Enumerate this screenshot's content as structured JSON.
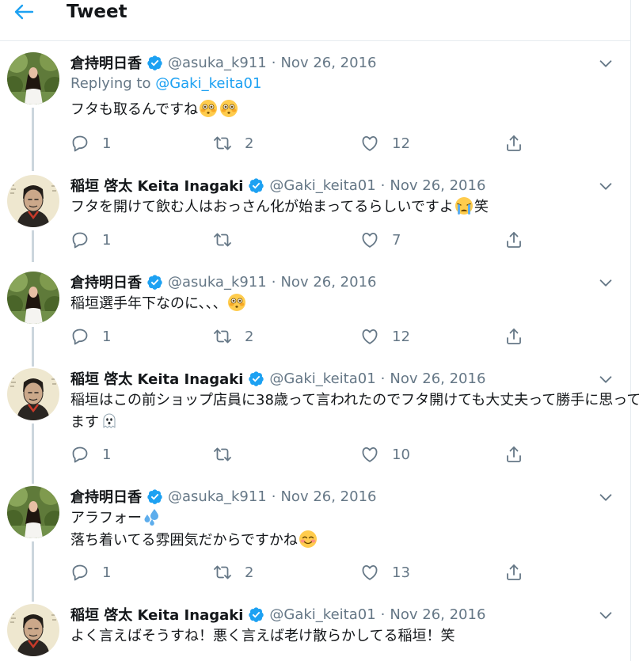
{
  "header": {
    "title": "Tweet"
  },
  "colors": {
    "accent": "#1da1f2",
    "muted": "#657786",
    "text": "#14171a",
    "thread_line": "#ccd6dd"
  },
  "tweets": [
    {
      "name": "倉持明日香",
      "handle": "@asuka_k911",
      "separator": "·",
      "time": "Nov 26, 2016",
      "replying_label": "Replying to ",
      "replying_handle": "@Gaki_keita01",
      "lines": [
        "フタも取るんですね"
      ],
      "emoji": [
        "flushed-face",
        "flushed-face"
      ],
      "replies": "1",
      "retweets": "2",
      "likes": "12"
    },
    {
      "name": "稲垣 啓太 Keita Inagaki",
      "handle": "@Gaki_keita01",
      "separator": "·",
      "time": "Nov 26, 2016",
      "lines": [
        "フタを開けて飲む人はおっさん化が始まってるらしいですよ",
        "笑"
      ],
      "emoji": [
        "loudly-crying-face"
      ],
      "replies": "1",
      "retweets": "",
      "likes": "7"
    },
    {
      "name": "倉持明日香",
      "handle": "@asuka_k911",
      "separator": "·",
      "time": "Nov 26, 2016",
      "lines": [
        "稲垣選手年下なのに、、、"
      ],
      "emoji": [
        "flushed-face"
      ],
      "replies": "1",
      "retweets": "2",
      "likes": "12"
    },
    {
      "name": "稲垣 啓太 Keita Inagaki",
      "handle": "@Gaki_keita01",
      "separator": "·",
      "time": "Nov 26, 2016",
      "lines": [
        "稲垣はこの前ショップ店員に38歳って言われたのでフタ開けても大丈夫って勝手に思って",
        "ます"
      ],
      "emoji": [
        "ghost"
      ],
      "replies": "1",
      "retweets": "",
      "likes": "10"
    },
    {
      "name": "倉持明日香",
      "handle": "@asuka_k911",
      "separator": "·",
      "time": "Nov 26, 2016",
      "lines": [
        "アラフォー",
        "落ち着いてる雰囲気だからですかね"
      ],
      "emoji": [
        "sweat-droplets",
        "smiling-face"
      ],
      "replies": "1",
      "retweets": "2",
      "likes": "13"
    },
    {
      "name": "稲垣 啓太 Keita Inagaki",
      "handle": "@Gaki_keita01",
      "separator": "·",
      "time": "Nov 26, 2016",
      "lines": [
        "よく言えばそうすね！悪く言えば老け散らかしてる稲垣！笑"
      ]
    }
  ]
}
